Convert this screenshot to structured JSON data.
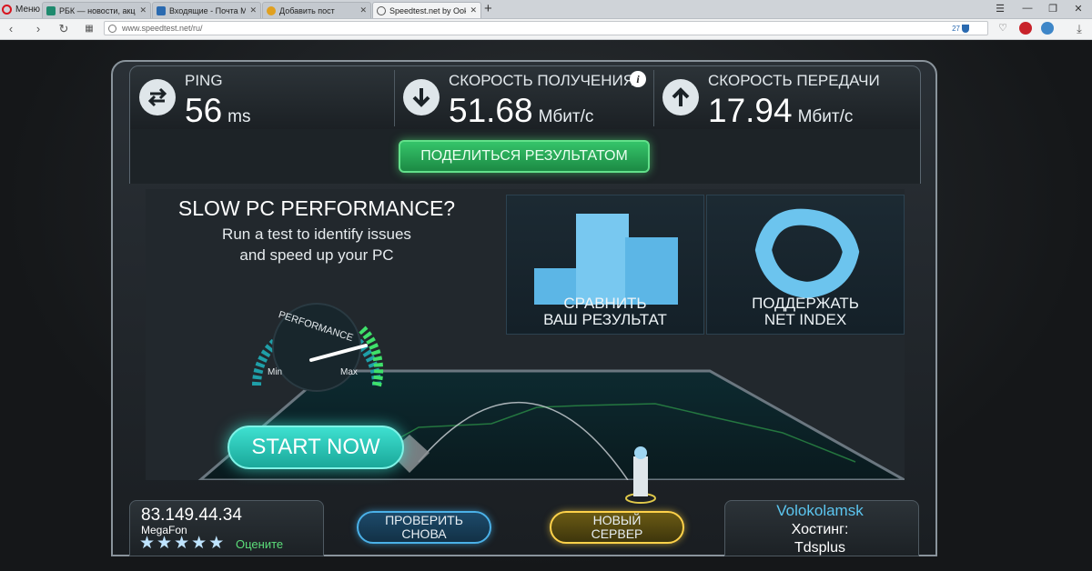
{
  "browser": {
    "menu_label": "Меню",
    "tabs": [
      {
        "title": "РБК — новости, акции, к",
        "active": false,
        "favicon_color": "#1e8a6e"
      },
      {
        "title": "Входящие - Почта Mail.R",
        "active": false,
        "favicon_color": "#2a6ab0"
      },
      {
        "title": "Добавить пост",
        "active": false,
        "favicon_color": "#e0a020"
      },
      {
        "title": "Speedtest.net by Ookla - S",
        "active": true,
        "favicon_color": "#555555"
      }
    ],
    "address": "www.speedtest.net/ru/",
    "badge_count": "27"
  },
  "metrics": {
    "ping": {
      "label": "PING",
      "value": "56",
      "unit": "ms",
      "icon": "ping-arrows-icon"
    },
    "download": {
      "label": "СКОРОСТЬ ПОЛУЧЕНИЯ",
      "value": "51.68",
      "unit": "Мбит/с",
      "icon": "download-arrow-icon"
    },
    "upload": {
      "label": "СКОРОСТЬ ПЕРЕДАЧИ",
      "value": "17.94",
      "unit": "Мбит/с",
      "icon": "upload-arrow-icon"
    }
  },
  "info_glyph": "i",
  "share_label": "ПОДЕЛИТЬСЯ РЕЗУЛЬТАТОМ",
  "ad": {
    "title": "SLOW PC PERFORMANCE?",
    "line1": "Run a test to identify issues",
    "line2": "and speed up your PC",
    "gauge_label": "PERFORMANCE",
    "gauge_min": "Min",
    "gauge_max": "Max",
    "start_label": "START NOW"
  },
  "tiles": {
    "compare": {
      "line1": "СРАВНИТЬ",
      "line2": "ВАШ РЕЗУЛЬТАТ"
    },
    "support": {
      "line1": "ПОДДЕРЖАТЬ",
      "line2": "NET INDEX"
    }
  },
  "client": {
    "ip": "83.149.44.34",
    "isp": "MegaFon",
    "rating_stars": 5,
    "rate_label": "Оцените"
  },
  "buttons": {
    "retest": {
      "line1": "ПРОВЕРИТЬ",
      "line2": "СНОВА"
    },
    "new_server": {
      "line1": "НОВЫЙ",
      "line2": "СЕРВЕР"
    }
  },
  "server": {
    "city": "Volokolamsk",
    "host_label": "Хостинг:",
    "host_name": "Tdsplus"
  },
  "colors": {
    "accent_green": "#35c46a",
    "accent_cyan": "#3ee0d0",
    "accent_blue": "#4bb1e8",
    "accent_yellow": "#ffd24a"
  }
}
